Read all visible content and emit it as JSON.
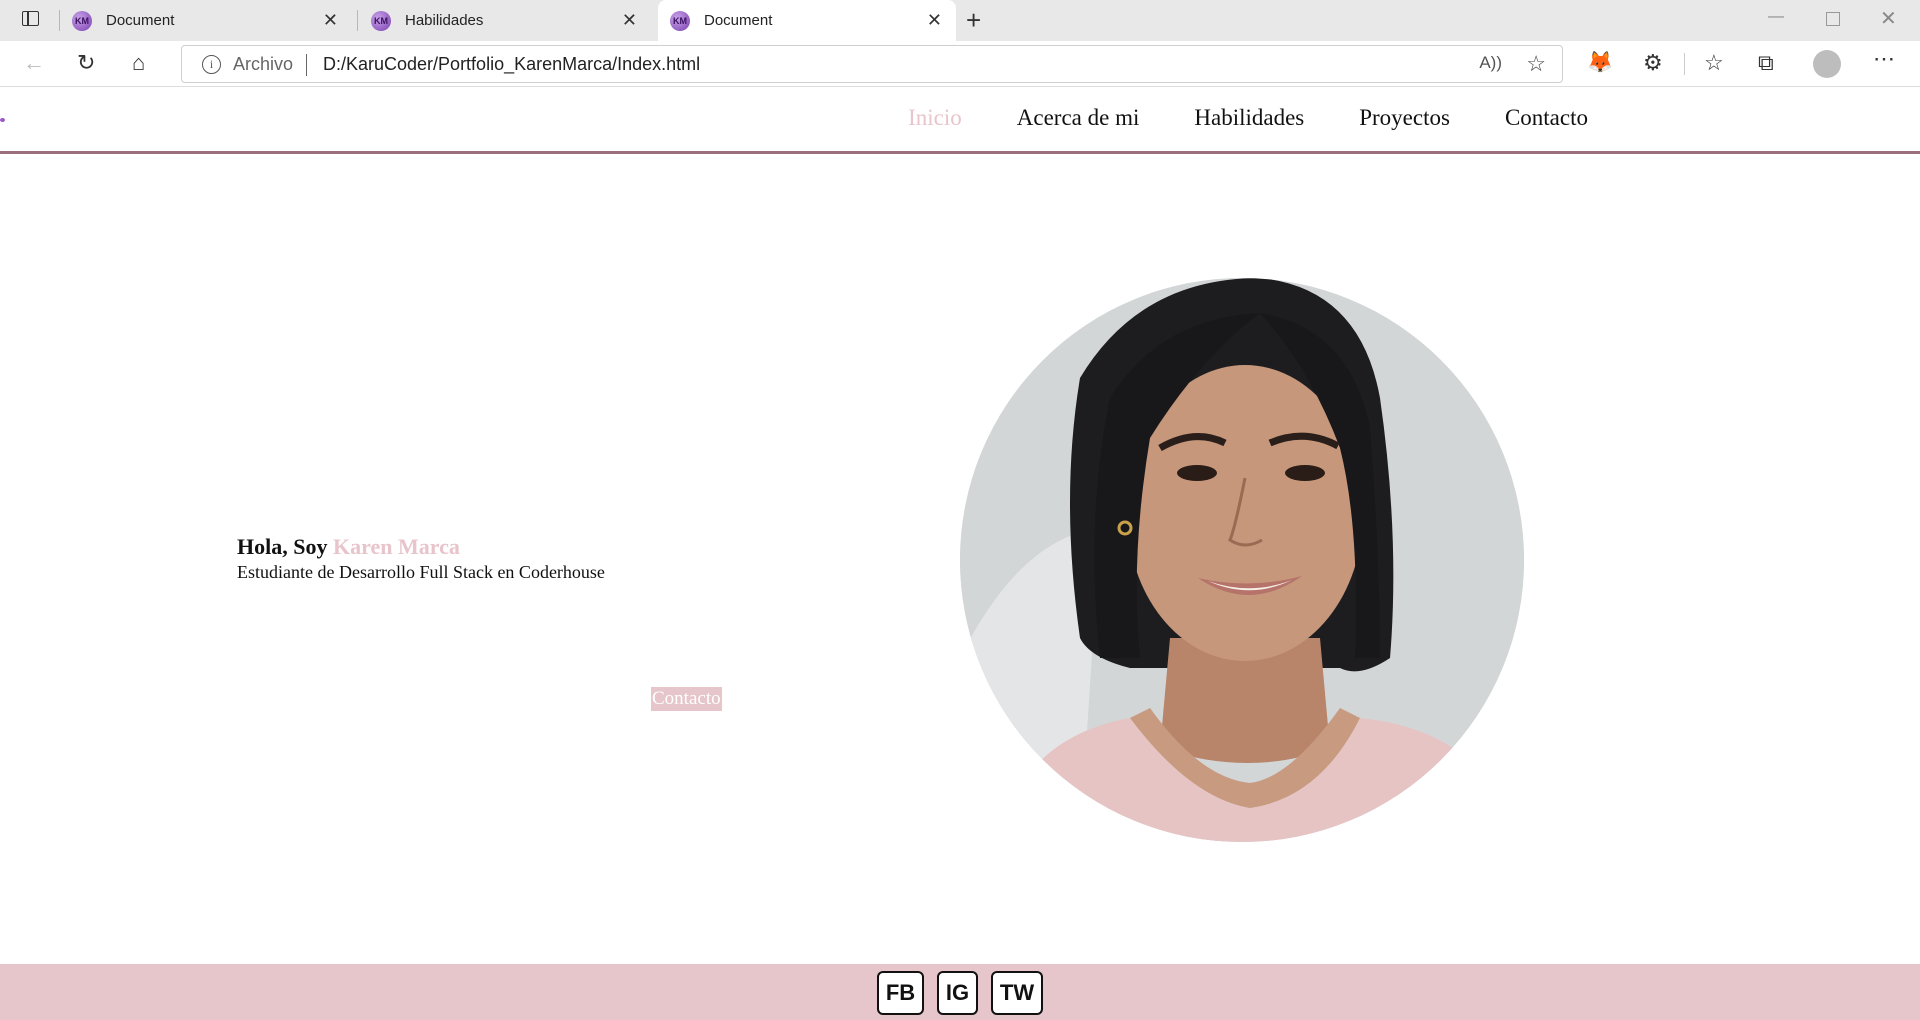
{
  "browser": {
    "tabs": [
      {
        "title": "Document",
        "favicon": "KM"
      },
      {
        "title": "Habilidades",
        "favicon": "KM"
      },
      {
        "title": "Document",
        "favicon": "KM"
      }
    ],
    "address": {
      "scheme_label": "Archivo",
      "url": "D:/KaruCoder/Portfolio_KarenMarca/Index.html"
    }
  },
  "nav": {
    "items": [
      "Inicio",
      "Acerca de mi",
      "Habilidades",
      "Proyectos",
      "Contacto"
    ],
    "active": "Inicio"
  },
  "hero": {
    "greeting": "Hola, Soy",
    "name": "Karen Marca",
    "subtitle": "Estudiante de Desarrollo Full Stack en Coderhouse",
    "button": "Contacto"
  },
  "footer": {
    "social": [
      "FB",
      "IG",
      "TW"
    ]
  },
  "colors": {
    "accent": "#e6c5cb",
    "nav_border": "#9c6f7e"
  }
}
